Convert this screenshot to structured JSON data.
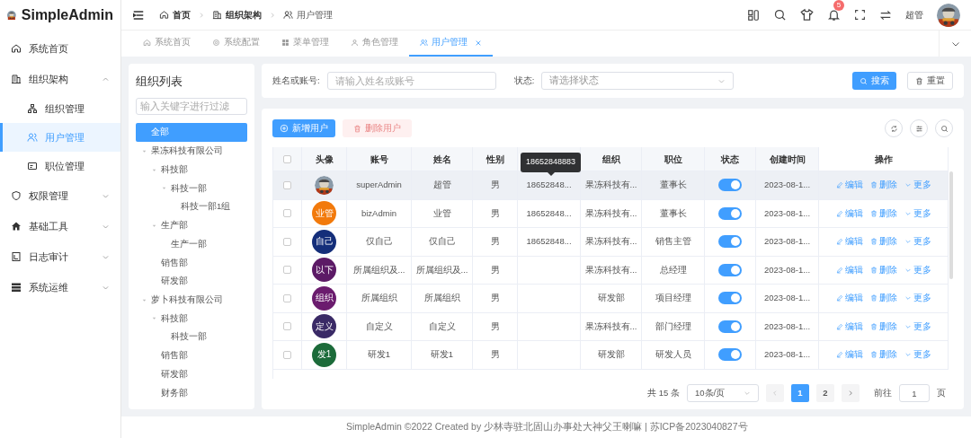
{
  "app": {
    "name": "SimpleAdmin"
  },
  "sidebar": {
    "items": [
      {
        "label": "系统首页",
        "kind": "home",
        "selected": false
      },
      {
        "label": "组织架构",
        "kind": "org",
        "expanded": true,
        "selected": false,
        "children": [
          {
            "label": "组织管理",
            "kind": "tree",
            "selected": false
          },
          {
            "label": "用户管理",
            "kind": "users",
            "selected": true
          },
          {
            "label": "职位管理",
            "kind": "card",
            "selected": false
          }
        ]
      },
      {
        "label": "权限管理",
        "kind": "shield",
        "expanded": false,
        "selected": false
      },
      {
        "label": "基础工具",
        "kind": "house",
        "expanded": false,
        "selected": false
      },
      {
        "label": "日志审计",
        "kind": "doc",
        "expanded": false,
        "selected": false
      },
      {
        "label": "系统运维",
        "kind": "server",
        "expanded": false,
        "selected": false
      }
    ]
  },
  "breadcrumb": [
    {
      "label": "首页",
      "kind": "home"
    },
    {
      "label": "组织架构",
      "kind": "org"
    },
    {
      "label": "用户管理",
      "kind": "users"
    }
  ],
  "header": {
    "notification_count": "5",
    "user_name": "超管"
  },
  "tabs": [
    {
      "label": "系统首页",
      "kind": "home",
      "selected": false
    },
    {
      "label": "系统配置",
      "kind": "gear",
      "selected": false
    },
    {
      "label": "菜单管理",
      "kind": "grid",
      "selected": false
    },
    {
      "label": "角色管理",
      "kind": "user",
      "selected": false
    },
    {
      "label": "用户管理",
      "kind": "users",
      "selected": true
    }
  ],
  "org_tree": {
    "title": "组织列表",
    "filter_placeholder": "输入关键字进行过滤",
    "nodes": [
      {
        "label": "全部",
        "selected": true
      },
      {
        "label": "果冻科技有限公司",
        "selected": false,
        "expanded": true,
        "children": [
          {
            "label": "科技部",
            "selected": false,
            "expanded": true,
            "children": [
              {
                "label": "科技一部",
                "selected": false,
                "expanded": true,
                "children": [
                  {
                    "label": "科技一部1组",
                    "selected": false
                  }
                ]
              }
            ]
          },
          {
            "label": "生产部",
            "selected": false,
            "expanded": true,
            "children": [
              {
                "label": "生产一部",
                "selected": false
              }
            ]
          },
          {
            "label": "销售部",
            "selected": false
          },
          {
            "label": "研发部",
            "selected": false
          }
        ]
      },
      {
        "label": "萝卜科技有限公司",
        "selected": false,
        "expanded": true,
        "children": [
          {
            "label": "科技部",
            "selected": false,
            "expanded": true,
            "children": [
              {
                "label": "科技一部",
                "selected": false
              }
            ]
          },
          {
            "label": "销售部",
            "selected": false
          },
          {
            "label": "研发部",
            "selected": false
          },
          {
            "label": "财务部",
            "selected": false
          }
        ]
      }
    ]
  },
  "search_form": {
    "name_label": "姓名或账号:",
    "name_placeholder": "请输入姓名或账号",
    "status_label": "状态:",
    "status_placeholder": "请选择状态",
    "search_button": "搜索",
    "reset_button": "重置"
  },
  "toolbar": {
    "add_button": "新增用户",
    "delete_button": "删除用户",
    "delete_disabled": true
  },
  "table": {
    "columns": [
      "头像",
      "账号",
      "姓名",
      "性别",
      "",
      "组织",
      "职位",
      "状态",
      "创建时间",
      "操作"
    ],
    "tooltip": "18652848883",
    "select_all_checked": false,
    "rows": [
      {
        "avatar": {
          "kind": "picture"
        },
        "account": "superAdmin",
        "name": "超管",
        "gender": "男",
        "phone": "18652848...",
        "org": "果冻科技有...",
        "position": "董事长",
        "on": true,
        "created": "2023-08-1...",
        "highlighted": true,
        "checked": false,
        "actions": [
          "编辑",
          "删除",
          "更多"
        ]
      },
      {
        "avatar": {
          "kind": "text",
          "text": "业管",
          "color": "#f27a0c"
        },
        "account": "bizAdmin",
        "name": "业管",
        "gender": "男",
        "phone": "18652848...",
        "org": "果冻科技有...",
        "position": "董事长",
        "on": true,
        "created": "2023-08-1...",
        "highlighted": false,
        "checked": false,
        "actions": [
          "编辑",
          "删除",
          "更多"
        ]
      },
      {
        "avatar": {
          "kind": "text",
          "text": "自己",
          "color": "#142e7a"
        },
        "account": "仅自己",
        "name": "仅自己",
        "gender": "男",
        "phone": "18652848...",
        "org": "果冻科技有...",
        "position": "销售主管",
        "on": true,
        "created": "2023-08-1...",
        "highlighted": false,
        "checked": false,
        "actions": [
          "编辑",
          "删除",
          "更多"
        ]
      },
      {
        "avatar": {
          "kind": "text",
          "text": "以下",
          "color": "#5c1a66"
        },
        "account": "所属组织及...",
        "name": "所属组织及...",
        "gender": "男",
        "org": "果冻科技有...",
        "position": "总经理",
        "on": true,
        "created": "2023-08-1...",
        "highlighted": false,
        "checked": false,
        "actions": [
          "编辑",
          "删除",
          "更多"
        ]
      },
      {
        "avatar": {
          "kind": "text",
          "text": "组织",
          "color": "#6b1c6e"
        },
        "account": "所属组织",
        "name": "所属组织",
        "gender": "男",
        "org": "研发部",
        "position": "项目经理",
        "on": true,
        "created": "2023-08-1...",
        "highlighted": false,
        "checked": false,
        "actions": [
          "编辑",
          "删除",
          "更多"
        ]
      },
      {
        "avatar": {
          "kind": "text",
          "text": "定义",
          "color": "#3a2a66"
        },
        "account": "自定义",
        "name": "自定义",
        "gender": "男",
        "org": "果冻科技有...",
        "position": "部门经理",
        "on": true,
        "created": "2023-08-1...",
        "highlighted": false,
        "checked": false,
        "actions": [
          "编辑",
          "删除",
          "更多"
        ]
      },
      {
        "avatar": {
          "kind": "text",
          "text": "发1",
          "color": "#1c6b3a"
        },
        "account": "研发1",
        "name": "研发1",
        "gender": "男",
        "org": "研发部",
        "position": "研发人员",
        "on": true,
        "created": "2023-08-1...",
        "highlighted": false,
        "checked": false,
        "actions": [
          "编辑",
          "删除",
          "更多"
        ]
      }
    ]
  },
  "pagination": {
    "total": "共 15 条",
    "page_size": "10条/页",
    "pages": [
      {
        "label": "1",
        "selected": true
      },
      {
        "label": "2",
        "selected": false
      }
    ],
    "goto_label": "前往",
    "goto_value": "1",
    "goto_suffix": "页"
  },
  "footer": {
    "text": "SimpleAdmin ©2022 Created by 少林寺驻北固山办事处大神父王喇嘛 | 苏ICP备2023040827号"
  }
}
